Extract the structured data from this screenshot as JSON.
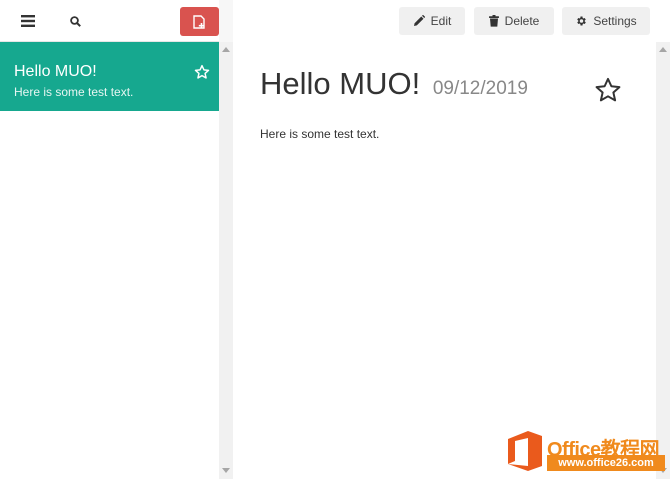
{
  "sidebar": {
    "toolbar": {
      "menu_icon": "hamburger-icon",
      "search_icon": "search-icon",
      "new_note_icon": "new-note-icon"
    },
    "notes": [
      {
        "title": "Hello MUO!",
        "preview": "Here is some test text.",
        "starred": false,
        "selected": true
      }
    ]
  },
  "toolbar": {
    "edit_label": "Edit",
    "delete_label": "Delete",
    "settings_label": "Settings"
  },
  "note": {
    "title": "Hello MUO!",
    "date": "09/12/2019",
    "body": "Here is some test text."
  },
  "watermark": {
    "title": "Office教程网",
    "url": "www.office26.com"
  },
  "colors": {
    "accent": "#16a88f",
    "new_note_button": "#d9534f",
    "watermark": "#f08a1d"
  }
}
